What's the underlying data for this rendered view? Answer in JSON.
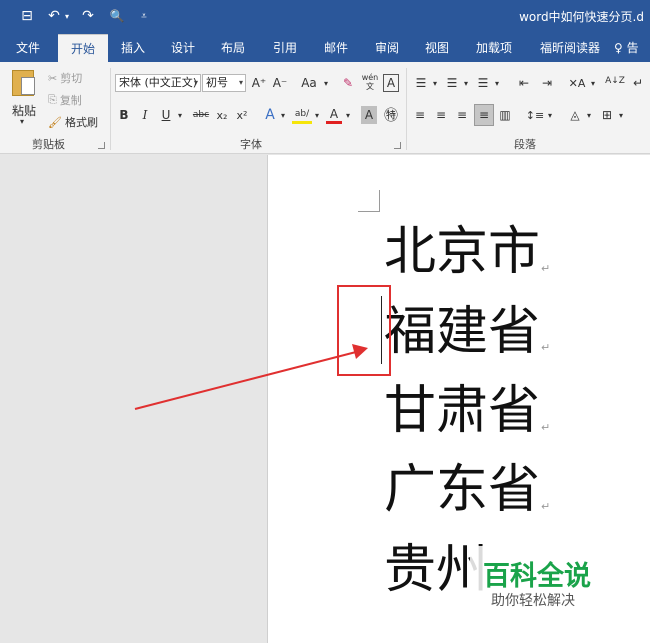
{
  "titlebar": {
    "title": "word中如何快速分页.d",
    "qat": {
      "save_icon": "⊟",
      "undo_icon": "↶",
      "undo_drop": "▾",
      "redo_icon": "↷",
      "preview_icon": "🔍",
      "customize_icon": "⩡"
    }
  },
  "tabs": [
    "文件",
    "开始",
    "插入",
    "设计",
    "布局",
    "引用",
    "邮件",
    "审阅",
    "视图",
    "加载项",
    "福昕阅读器",
    "♀ 告"
  ],
  "ribbon": {
    "clipboard": {
      "paste_label": "粘贴",
      "paste_drop": "▾",
      "cut_label": "剪切",
      "copy_label": "复制",
      "format_painter_label": "格式刷",
      "group_label": "剪贴板"
    },
    "font": {
      "font_name": "宋体 (中文正文)",
      "font_size": "初号",
      "grow_icon": "A⁺",
      "shrink_icon": "A⁻",
      "case_icon": "Aa",
      "clear_icon": "✎",
      "phonetic_icon": "wén\n文",
      "border_icon": "A",
      "bold": "B",
      "italic": "I",
      "underline": "U",
      "strike": "abc",
      "subscript": "x₂",
      "superscript": "x²",
      "effects_icon": "A",
      "highlight_icon": "ab/",
      "color_icon": "A",
      "shading_icon": "A",
      "enclose_icon": "㊕",
      "group_label": "字体"
    },
    "paragraph": {
      "bullets": "☰",
      "numbering": "☰",
      "multilevel": "☰",
      "decrease_indent": "⇤",
      "increase_indent": "⇥",
      "chinese_layout": "✕A",
      "sort": "A↓Z",
      "show_marks": "↵",
      "align_left": "≡",
      "align_center": "≡",
      "align_right": "≡",
      "justify": "≡",
      "distributed": "▥",
      "line_spacing": "↕≡",
      "shading": "◬",
      "borders": "⊞",
      "group_label": "段落"
    }
  },
  "document": {
    "lines": [
      "北京市",
      "福建省",
      "甘肃省",
      "广东省",
      "贵州"
    ],
    "paragraph_mark": "↵"
  },
  "watermark": {
    "title": "百科全说",
    "subtitle": "助你轻松解决"
  },
  "colors": {
    "brand_blue": "#2b579a",
    "annotation_red": "#e03030",
    "watermark_green": "#1aa34a"
  }
}
